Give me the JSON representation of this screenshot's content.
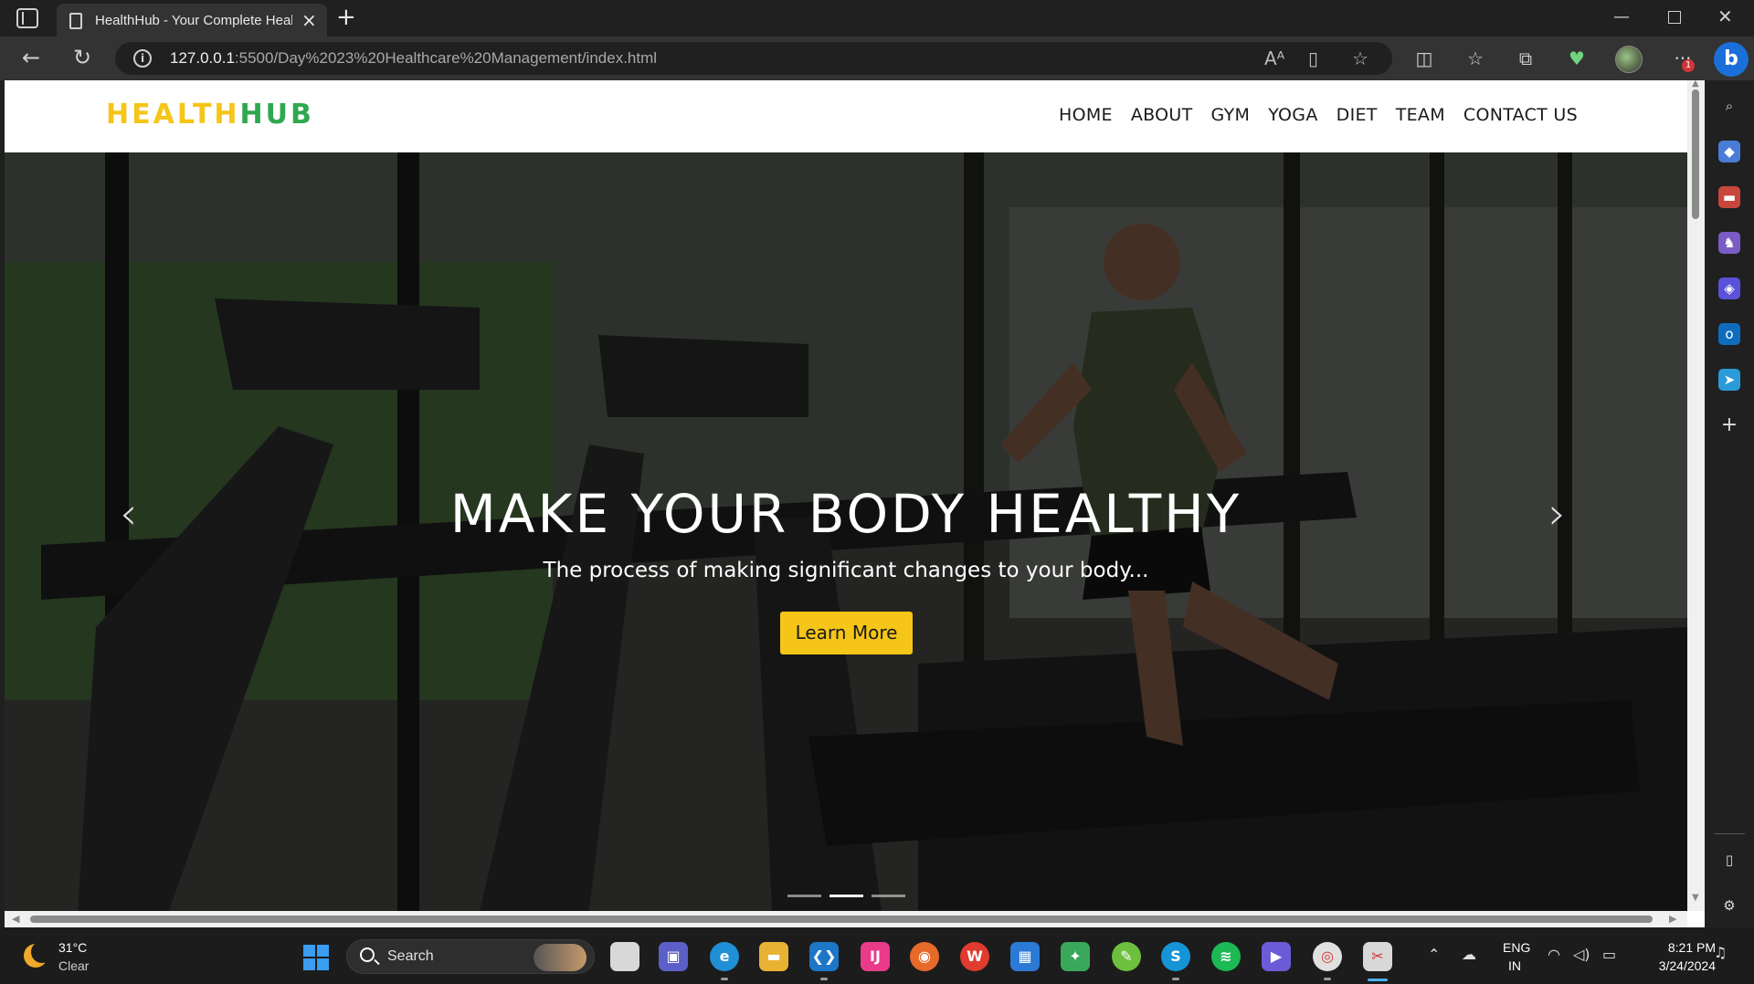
{
  "browser": {
    "tab_title": "HealthHub - Your Complete Heal",
    "url_host": "127.0.0.1",
    "url_rest": ":5500/Day%2023%20Healthcare%20Management/index.html",
    "notification_count": "1",
    "copilot_label": "b"
  },
  "site": {
    "logo_part1": "HEALTH",
    "logo_part2": "HUB",
    "logo_colors": {
      "health": "#f5c518",
      "hub": "#2fa84f"
    },
    "nav": [
      "HOME",
      "ABOUT",
      "GYM",
      "YOGA",
      "DIET",
      "TEAM",
      "CONTACT US"
    ]
  },
  "hero": {
    "title": "MAKE YOUR BODY HEALTHY",
    "subtitle": "The process of making significant changes to your body...",
    "button_label": "Learn More",
    "button_color": "#f5c518",
    "prev_arrow": "‹",
    "next_arrow": "›",
    "slides_total": 3,
    "active_slide": 2
  },
  "taskbar": {
    "weather_temp": "31°C",
    "weather_condition": "Clear",
    "search_label": "Search",
    "lang_line1": "ENG",
    "lang_line2": "IN",
    "time": "8:21 PM",
    "date": "3/24/2024",
    "apps": [
      "file-explorer-window",
      "teams",
      "edge",
      "file-explorer",
      "vscode",
      "intellij",
      "firefox",
      "wps-office",
      "microsoft-store",
      "photo-app",
      "feather-app",
      "skype",
      "spotify",
      "clipchamp",
      "chrome",
      "snipping-tool"
    ]
  }
}
